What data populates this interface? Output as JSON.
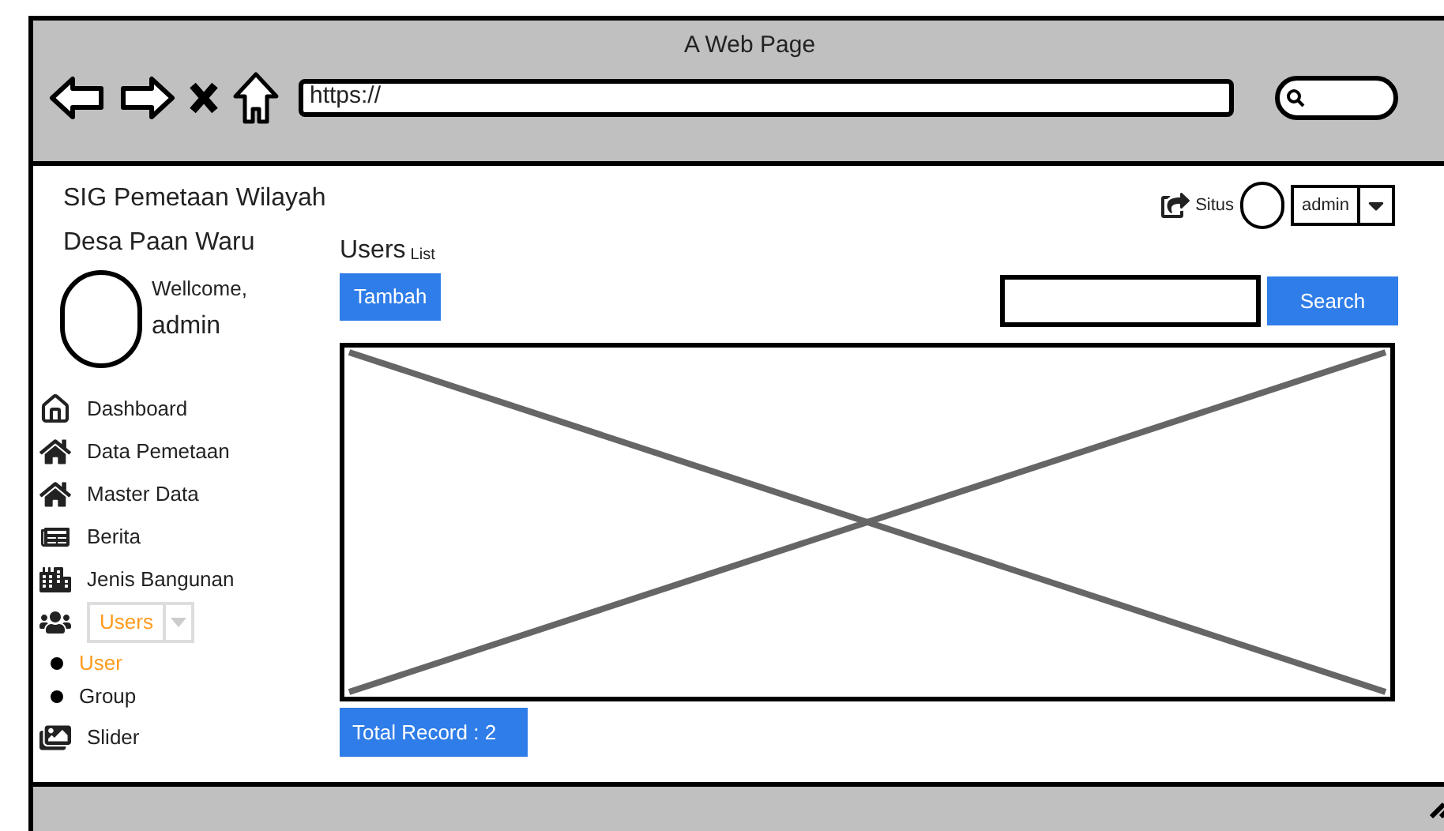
{
  "browser": {
    "title": "A Web Page",
    "url": "https://"
  },
  "app_title": [
    "SIG Pemetaan Wilayah",
    "Desa Paan Waru"
  ],
  "top_bar": {
    "link": "Situs",
    "user_menu": "admin"
  },
  "profile": {
    "greeting": "Wellcome,",
    "name": "admin"
  },
  "menu": [
    {
      "label": "Dashboard",
      "kind": "link",
      "selected": false
    },
    {
      "label": "Data Pemetaan",
      "kind": "link",
      "selected": false
    },
    {
      "label": "Master Data",
      "kind": "link",
      "selected": false
    },
    {
      "label": "Berita",
      "kind": "link",
      "selected": false
    },
    {
      "label": "Jenis Bangunan",
      "kind": "link",
      "selected": false
    },
    {
      "label": "Users",
      "kind": "dropdown",
      "selected": true,
      "children": [
        {
          "label": "User",
          "selected": true
        },
        {
          "label": "Group",
          "selected": false
        }
      ]
    },
    {
      "label": "Slider",
      "kind": "link",
      "selected": false
    }
  ],
  "page": {
    "title": "Users",
    "subtitle": "List",
    "add_button": "Tambah",
    "search_button": "Search",
    "footer": "Total Record : 2"
  }
}
